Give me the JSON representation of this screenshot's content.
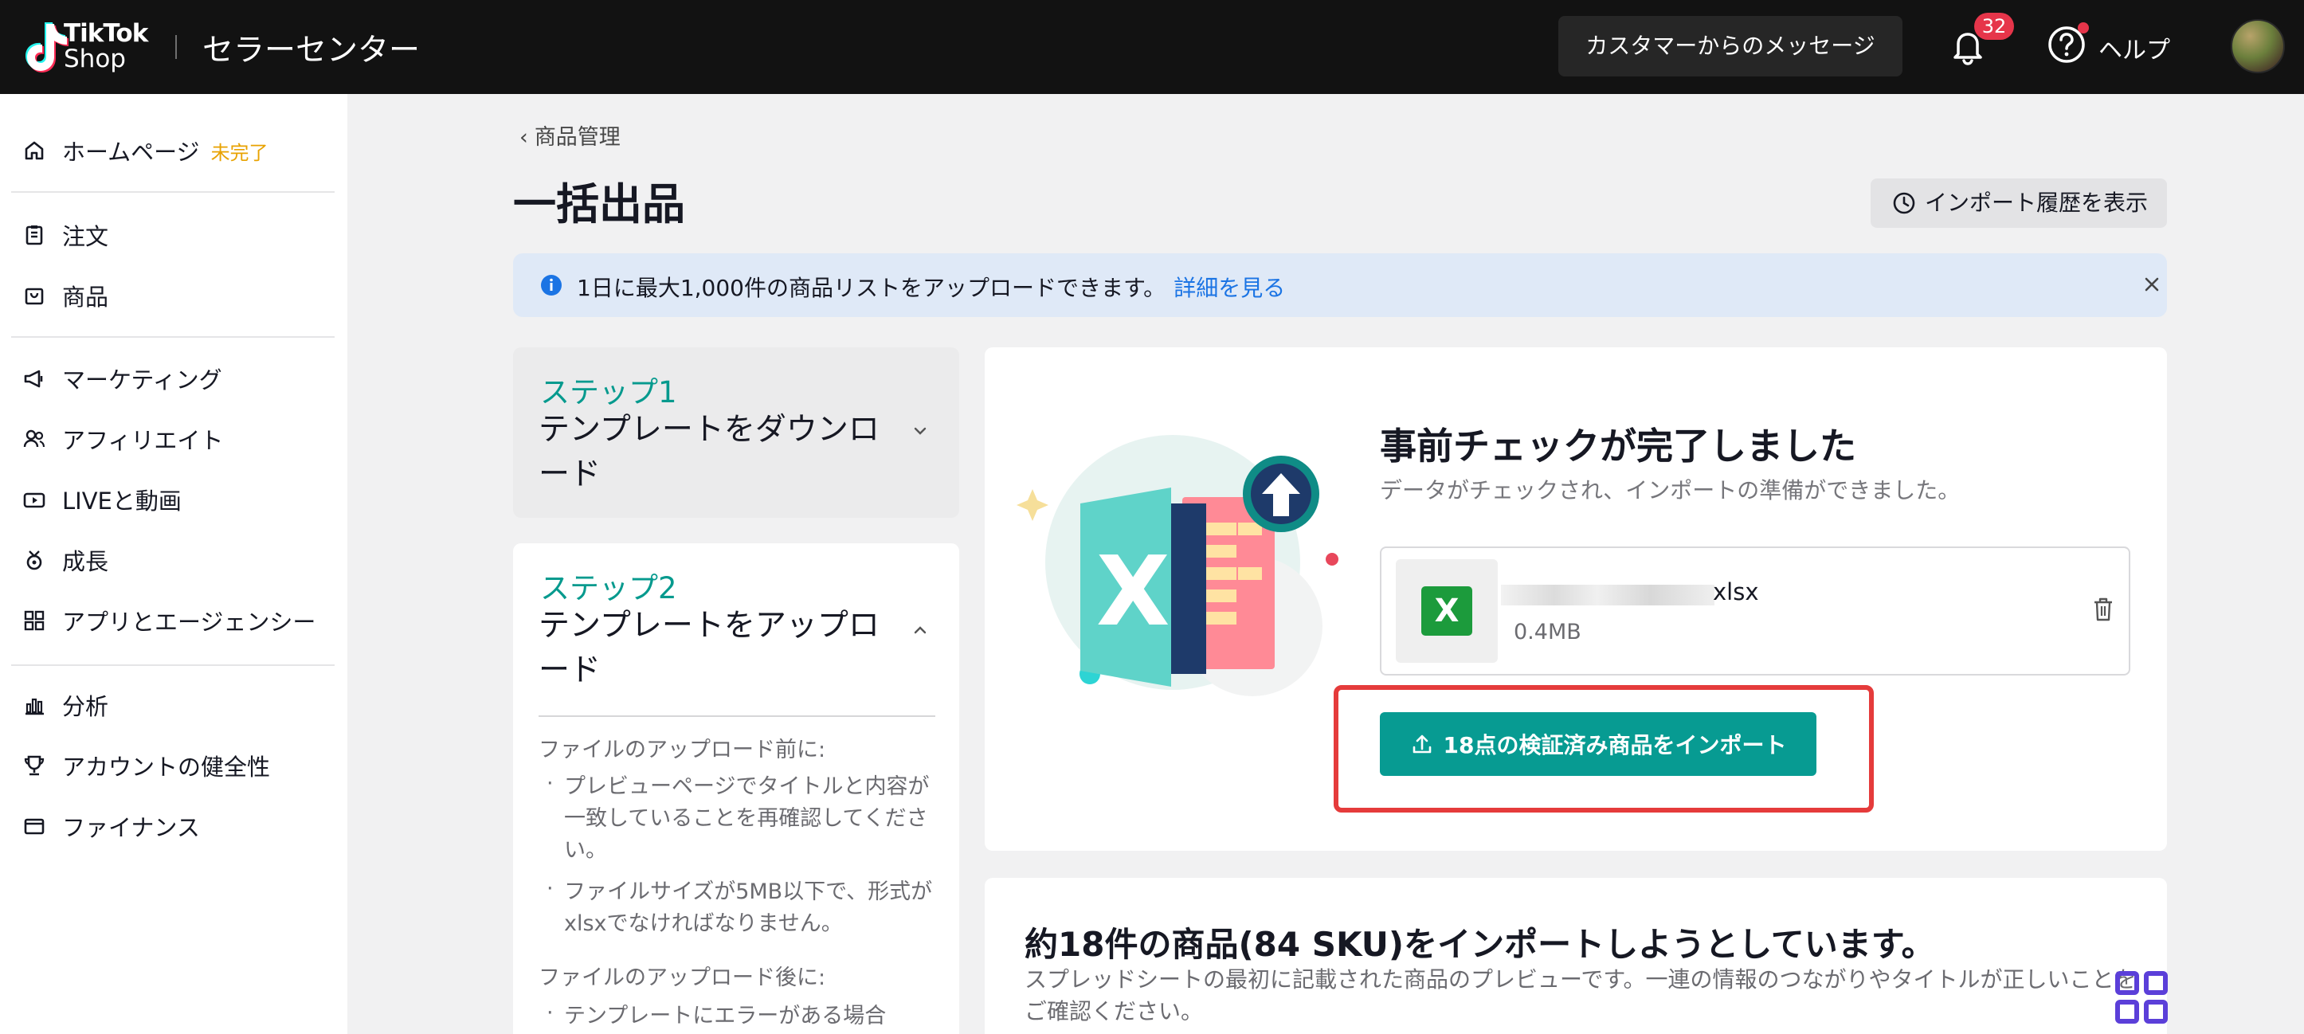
{
  "topbar": {
    "brand_line1": "TikTok",
    "brand_line2": "Shop",
    "app_title": "セラーセンター",
    "messages_button": "カスタマーからのメッセージ",
    "notification_count": "32",
    "help_label": "ヘルプ"
  },
  "sidebar": {
    "items": [
      {
        "label": "ホームページ",
        "badge": "未完了",
        "icon": "home-icon"
      },
      {
        "label": "注文",
        "icon": "clipboard-icon"
      },
      {
        "label": "商品",
        "icon": "bag-icon"
      },
      {
        "label": "マーケティング",
        "icon": "megaphone-icon"
      },
      {
        "label": "アフィリエイト",
        "icon": "people-icon"
      },
      {
        "label": "LIVEと動画",
        "icon": "video-icon"
      },
      {
        "label": "成長",
        "icon": "growth-icon"
      },
      {
        "label": "アプリとエージェンシー",
        "icon": "apps-grid-icon"
      },
      {
        "label": "分析",
        "icon": "chart-icon"
      },
      {
        "label": "アカウントの健全性",
        "icon": "trophy-icon"
      },
      {
        "label": "ファイナンス",
        "icon": "wallet-icon"
      }
    ]
  },
  "main": {
    "breadcrumb": "商品管理",
    "title": "一括出品",
    "history_button": "インポート履歴を表示",
    "banner": {
      "text": "1日に最大1,000件の商品リストをアップロードできます。",
      "link": "詳細を見る"
    },
    "step1": {
      "number": "ステップ1",
      "title": "テンプレートをダウンロード"
    },
    "step2": {
      "number": "ステップ2",
      "title": "テンプレートをアップロード",
      "before_heading": "ファイルのアップロード前に:",
      "before_items": [
        "プレビューページでタイトルと内容が一致していることを再確認してください。",
        "ファイルサイズが5MB以下で、形式がxlsxでなければなりません。"
      ],
      "after_heading": "ファイルのアップロード後に:",
      "after_items": [
        "テンプレートにエラーがある場合"
      ]
    },
    "precheck": {
      "title": "事前チェックが完了しました",
      "subtitle": "データがチェックされ、インポートの準備ができました。",
      "file_icon_letter": "X",
      "file_ext": "xlsx",
      "file_size": "0.4MB",
      "import_button": "18点の検証済み商品をインポート"
    },
    "summary": {
      "title": "約18件の商品(84 SKU)をインポートしようとしています。",
      "subtitle": "スプレッドシートの最初に記載された商品のプレビューです。一連の情報のつながりやタイトルが正しいことをご確認ください。"
    }
  },
  "colors": {
    "accent_teal": "#079b92",
    "step_teal": "#069a8e",
    "highlight_red": "#e53b3b",
    "badge_red": "#e6354a",
    "warning_orange": "#e8a200",
    "link_blue": "#1b74e4"
  }
}
